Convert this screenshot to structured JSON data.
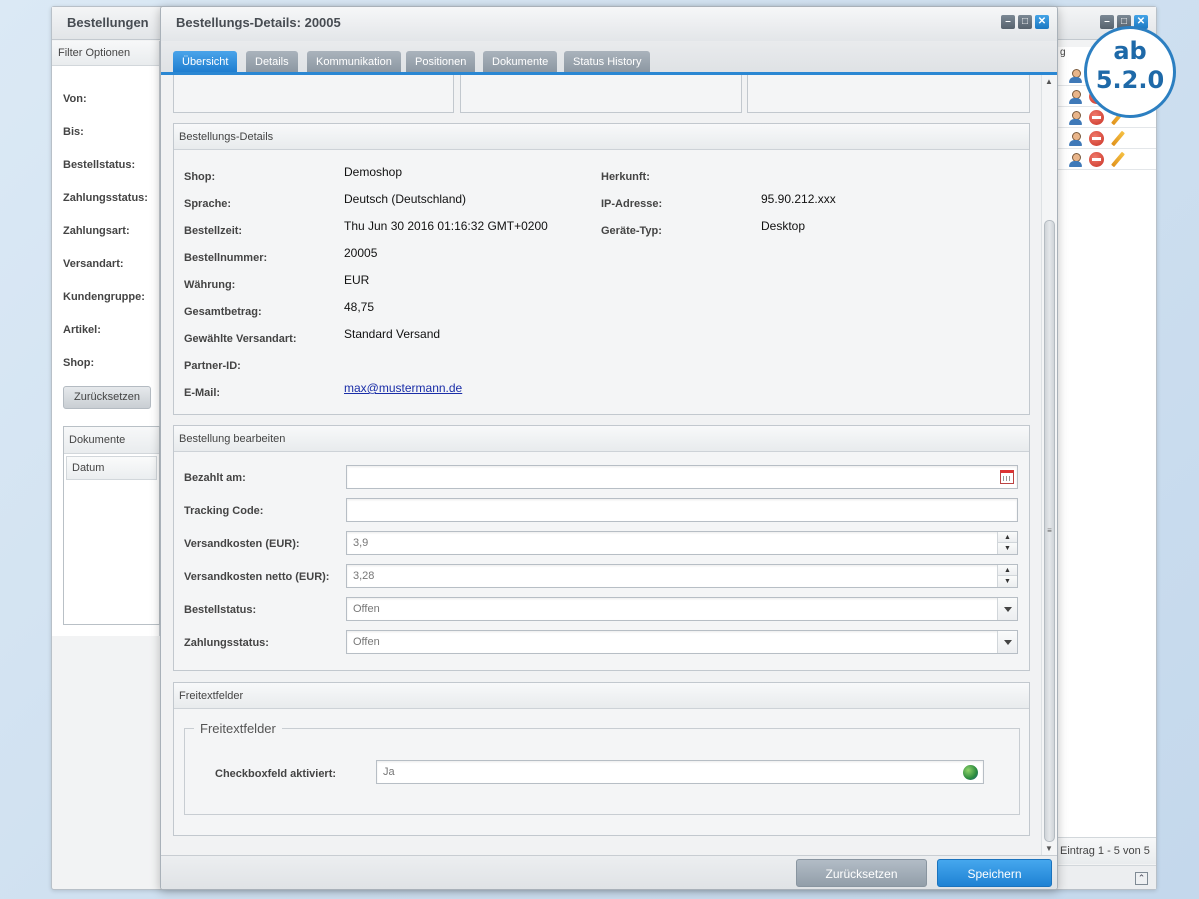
{
  "background_window": {
    "title": "Bestellungen",
    "filter_panel_title": "Filter Optionen",
    "filters": [
      "Von:",
      "Bis:",
      "Bestellstatus:",
      "Zahlungsstatus:",
      "Zahlungsart:",
      "Versandart:",
      "Kundengruppe:",
      "Artikel:",
      "Shop:"
    ],
    "reset_button": "Zurücksetzen",
    "documents_panel_title": "Dokumente",
    "documents_column": "Datum",
    "list_header_fragment": "g",
    "row_count": 5,
    "paging_text": "Eintrag 1 - 5 von 5"
  },
  "badge": {
    "line1": "ab",
    "line2": "5.2.0"
  },
  "dialog": {
    "title": "Bestellungs-Details: 20005",
    "window_controls": [
      "minimize-icon",
      "maximize-icon",
      "close-icon"
    ],
    "tabs": [
      {
        "label": "Übersicht",
        "active": true
      },
      {
        "label": "Details",
        "active": false
      },
      {
        "label": "Kommunikation",
        "active": false
      },
      {
        "label": "Positionen",
        "active": false
      },
      {
        "label": "Dokumente",
        "active": false
      },
      {
        "label": "Status History",
        "active": false
      }
    ],
    "order_details": {
      "title": "Bestellungs-Details",
      "left": [
        {
          "label": "Shop:",
          "value": "Demoshop"
        },
        {
          "label": "Sprache:",
          "value": "Deutsch (Deutschland)"
        },
        {
          "label": "Bestellzeit:",
          "value": "Thu Jun 30 2016 01:16:32 GMT+0200"
        },
        {
          "label": "Bestellnummer:",
          "value": "20005"
        },
        {
          "label": "Währung:",
          "value": "EUR"
        },
        {
          "label": "Gesamtbetrag:",
          "value": "48,75"
        },
        {
          "label": "Gewählte Versandart:",
          "value": "Standard Versand"
        },
        {
          "label": "Partner-ID:",
          "value": ""
        },
        {
          "label": "E-Mail:",
          "value": "max@mustermann.de"
        }
      ],
      "right": [
        {
          "label": "Herkunft:",
          "value": ""
        },
        {
          "label": "IP-Adresse:",
          "value": "95.90.212.xxx"
        },
        {
          "label": "Geräte-Typ:",
          "value": "Desktop"
        }
      ]
    },
    "edit_order": {
      "title": "Bestellung bearbeiten",
      "paid_label": "Bezahlt am:",
      "paid_value": "",
      "tracking_label": "Tracking Code:",
      "tracking_value": "",
      "shipping_label": "Versandkosten (EUR):",
      "shipping_value": "3,9",
      "shipping_net_label": "Versandkosten netto (EUR):",
      "shipping_net_value": "3,28",
      "order_status_label": "Bestellstatus:",
      "order_status_value": "Offen",
      "payment_status_label": "Zahlungsstatus:",
      "payment_status_value": "Offen"
    },
    "free_text": {
      "title": "Freitextfelder",
      "legend": "Freitextfelder",
      "checkbox_label": "Checkboxfeld aktiviert:",
      "checkbox_value": "Ja"
    },
    "footer": {
      "reset_label": "Zurücksetzen",
      "save_label": "Speichern"
    }
  },
  "colors": {
    "accent": "#2a87d3",
    "save_button": "#1f82d4",
    "badge": "#2c7fc1"
  }
}
